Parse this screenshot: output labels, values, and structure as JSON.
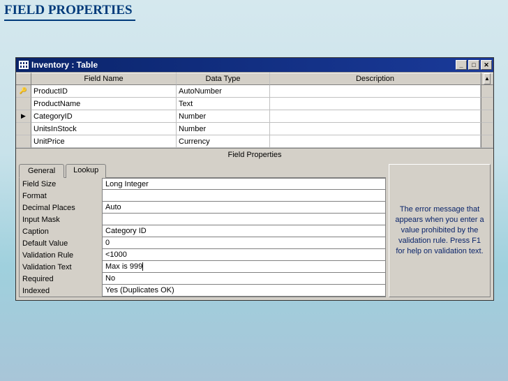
{
  "headline": "FIELD PROPERTIES",
  "window": {
    "title": "Inventory : Table",
    "columns": {
      "fieldName": "Field Name",
      "dataType": "Data Type",
      "description": "Description"
    },
    "rows": [
      {
        "marker": "key",
        "fieldName": "ProductID",
        "dataType": "AutoNumber",
        "description": ""
      },
      {
        "marker": "",
        "fieldName": "ProductName",
        "dataType": "Text",
        "description": ""
      },
      {
        "marker": "arrow",
        "fieldName": "CategoryID",
        "dataType": "Number",
        "description": ""
      },
      {
        "marker": "",
        "fieldName": "UnitsInStock",
        "dataType": "Number",
        "description": ""
      },
      {
        "marker": "",
        "fieldName": "UnitPrice",
        "dataType": "Currency",
        "description": ""
      }
    ]
  },
  "fieldProperties": {
    "header": "Field Properties",
    "tabs": {
      "general": "General",
      "lookup": "Lookup"
    },
    "props": [
      {
        "label": "Field Size",
        "value": "Long Integer"
      },
      {
        "label": "Format",
        "value": ""
      },
      {
        "label": "Decimal Places",
        "value": "Auto"
      },
      {
        "label": "Input Mask",
        "value": ""
      },
      {
        "label": "Caption",
        "value": "Category ID"
      },
      {
        "label": "Default Value",
        "value": "0"
      },
      {
        "label": "Validation Rule",
        "value": "<1000"
      },
      {
        "label": "Validation Text",
        "value": "Max is 999",
        "active": true
      },
      {
        "label": "Required",
        "value": "No"
      },
      {
        "label": "Indexed",
        "value": "Yes (Duplicates OK)"
      }
    ],
    "help": "The error message that appears when you enter a value prohibited by the validation rule. Press F1 for help on validation text."
  }
}
